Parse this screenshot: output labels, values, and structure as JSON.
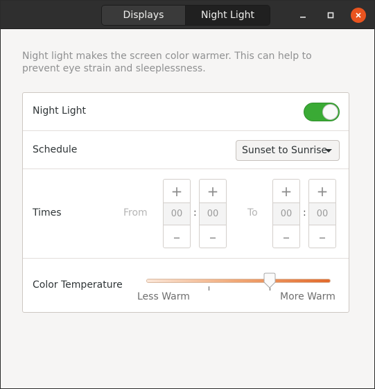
{
  "header": {
    "tabs": [
      {
        "label": "Displays",
        "active": false
      },
      {
        "label": "Night Light",
        "active": true
      }
    ],
    "minimize_icon": "minimize-icon",
    "maximize_icon": "maximize-icon",
    "close_icon": "close-icon",
    "close_color": "#e9541f"
  },
  "description": "Night light makes the screen color warmer. This can help to prevent eye strain and sleeplessness.",
  "night_light": {
    "label": "Night Light",
    "enabled": true,
    "accent": "#3aaa35"
  },
  "schedule": {
    "label": "Schedule",
    "value": "Sunset to Sunrise"
  },
  "times": {
    "label": "Times",
    "from_label": "From",
    "to_label": "To",
    "from": {
      "hours": "00",
      "minutes": "00"
    },
    "to": {
      "hours": "00",
      "minutes": "00"
    },
    "increment_symbol": "+",
    "decrement_symbol": "–",
    "separator": ":"
  },
  "color_temperature": {
    "label": "Color Temperature",
    "level": 0.67,
    "less_label": "Less Warm",
    "more_label": "More Warm"
  }
}
